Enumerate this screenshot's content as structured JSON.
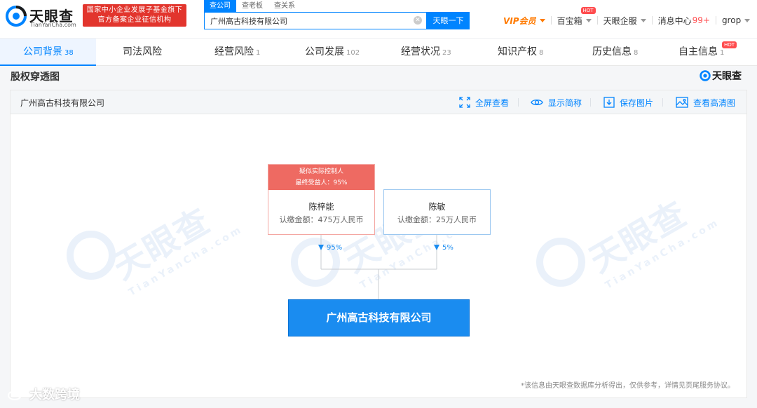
{
  "header": {
    "logo": {
      "name": "天眼查",
      "sub": "TianYanCha.com"
    },
    "gov_badge": {
      "line1": "国家中小企业发展子基金旗下",
      "line2": "官方备案企业征信机构"
    },
    "search": {
      "tabs": [
        "查公司",
        "查老板",
        "查关系"
      ],
      "active_tab": 0,
      "value": "广州高古科技有限公司",
      "clear_icon": "close-icon",
      "button": "天眼一下"
    },
    "nav": {
      "vip": "VIP会员",
      "treasure": "百宝箱",
      "treasure_hot": "HOT",
      "enterprise": "天眼企服",
      "messages": "消息中心",
      "messages_count": "99+",
      "user": "grop"
    }
  },
  "tabs": [
    {
      "label": "公司背景",
      "count": "38",
      "active": true
    },
    {
      "label": "司法风险",
      "count": ""
    },
    {
      "label": "经营风险",
      "count": "1"
    },
    {
      "label": "公司发展",
      "count": "102"
    },
    {
      "label": "经营状况",
      "count": "23"
    },
    {
      "label": "知识产权",
      "count": "8"
    },
    {
      "label": "历史信息",
      "count": "8"
    },
    {
      "label": "自主信息",
      "count": "1",
      "hot": "HOT"
    }
  ],
  "section": {
    "title": "股权穿透图",
    "brand": "天眼查"
  },
  "panel": {
    "company": "广州高古科技有限公司",
    "tools": {
      "fullscreen": "全屏查看",
      "short_name": "显示简称",
      "save_image": "保存图片",
      "hd_image": "查看高清图"
    },
    "watermark": "天眼查",
    "watermark_sub": "TianYanCha.com",
    "graph": {
      "controller": {
        "tag_line1": "疑似实际控制人",
        "tag_line2": "最终受益人：95%",
        "name": "陈梓能",
        "amount": "认缴金额：475万人民币",
        "share": "95%"
      },
      "holder": {
        "name": "陈敏",
        "amount": "认缴金额：25万人民币",
        "share": "5%"
      },
      "company": "广州高古科技有限公司"
    },
    "disclaimer": "*该信息由天眼查数据库分析得出，仅供参考，详情见页尾服务协议。"
  },
  "corner_watermark": "大数跨境",
  "colors": {
    "accent": "#0084ff",
    "controller_red": "#ee6a62",
    "vip_orange": "#ff7a00",
    "gov_red": "#e2352d"
  }
}
